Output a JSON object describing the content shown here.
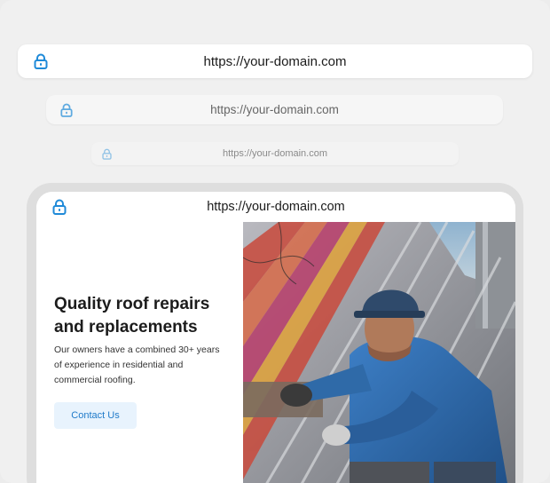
{
  "address_bars": [
    {
      "url": "https://your-domain.com",
      "icon": "lock-icon"
    },
    {
      "url": "https://your-domain.com",
      "icon": "lock-icon"
    },
    {
      "url": "https://your-domain.com",
      "icon": "lock-icon"
    }
  ],
  "device": {
    "url": "https://your-domain.com",
    "icon": "lock-icon",
    "hero": {
      "headline_line1": "Quality roof repairs",
      "headline_line2": "and replacements",
      "body_line1": "Our owners have a combined 30+ years",
      "body_line2": "of experience in residential and",
      "body_line3": "commercial roofing.",
      "cta_label": "Contact Us",
      "image_description": "roofer-working-on-metal-roof-photo"
    }
  },
  "colors": {
    "lock_icon": "#1f8ad8",
    "cta_background": "#e8f3fd",
    "cta_text": "#1f7ac9"
  }
}
